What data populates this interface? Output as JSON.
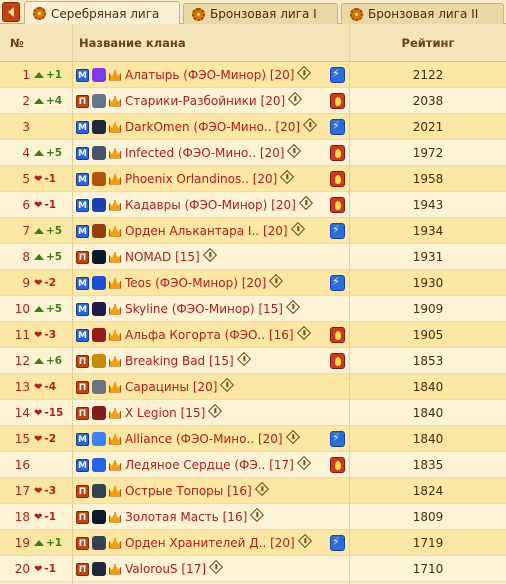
{
  "tabs": [
    {
      "label": "Серебряная лига",
      "active": true
    },
    {
      "label": "Бронзовая лига I",
      "active": false
    },
    {
      "label": "Бронзовая лига II",
      "active": false
    }
  ],
  "header": {
    "num": "№",
    "clan": "Название клана",
    "rating": "Рейтинг"
  },
  "rows": [
    {
      "rank": "1",
      "change": "+1",
      "dir": "up",
      "type": "М",
      "emblem": "#7c3aed",
      "name": "Алатырь (ФЭО-Минор)",
      "level": "[20]",
      "side": "bolt",
      "rating": "2122"
    },
    {
      "rank": "2",
      "change": "+4",
      "dir": "up",
      "type": "П",
      "emblem": "#64748b",
      "name": "Старики-Разбойники",
      "level": "[20]",
      "side": "fire",
      "rating": "2038"
    },
    {
      "rank": "3",
      "change": "",
      "dir": "",
      "type": "М",
      "emblem": "#1f2937",
      "name": "DarkOmen (ФЭО-Мино..",
      "level": "[20]",
      "side": "bolt",
      "rating": "2021"
    },
    {
      "rank": "4",
      "change": "+5",
      "dir": "up",
      "type": "М",
      "emblem": "#475569",
      "name": "Infected (ФЭО-Мино..",
      "level": "[20]",
      "side": "fire",
      "rating": "1972"
    },
    {
      "rank": "5",
      "change": "-1",
      "dir": "down",
      "type": "М",
      "emblem": "#b45309",
      "name": "Phoenix Orlandinos..",
      "level": "[20]",
      "side": "fire",
      "rating": "1958"
    },
    {
      "rank": "6",
      "change": "-1",
      "dir": "down",
      "type": "М",
      "emblem": "#1e40af",
      "name": "Кадавры (ФЭО-Минор)",
      "level": "[20]",
      "side": "fire",
      "rating": "1943"
    },
    {
      "rank": "7",
      "change": "+5",
      "dir": "up",
      "type": "М",
      "emblem": "#92400e",
      "name": "Орден Алькантара I..",
      "level": "[20]",
      "side": "bolt",
      "rating": "1934"
    },
    {
      "rank": "8",
      "change": "+5",
      "dir": "up",
      "type": "П",
      "emblem": "#0f172a",
      "name": "NOMAD",
      "level": "[15]",
      "side": "",
      "rating": "1931"
    },
    {
      "rank": "9",
      "change": "-2",
      "dir": "down",
      "type": "М",
      "emblem": "#1d4ed8",
      "name": "Teos (ФЭО-Минор)",
      "level": "[20]",
      "side": "bolt",
      "rating": "1930"
    },
    {
      "rank": "10",
      "change": "+5",
      "dir": "up",
      "type": "М",
      "emblem": "#1e1b4b",
      "name": "Skyline (ФЭО-Минор)",
      "level": "[15]",
      "side": "",
      "rating": "1909"
    },
    {
      "rank": "11",
      "change": "-3",
      "dir": "down",
      "type": "М",
      "emblem": "#991b1b",
      "name": "Альфа Когорта (ФЭО..",
      "level": "[16]",
      "side": "fire",
      "rating": "1905"
    },
    {
      "rank": "12",
      "change": "+6",
      "dir": "up",
      "type": "П",
      "emblem": "#ca8a04",
      "name": "Breaking Bad",
      "level": "[15]",
      "side": "fire",
      "rating": "1853"
    },
    {
      "rank": "13",
      "change": "-4",
      "dir": "down",
      "type": "П",
      "emblem": "#6b7280",
      "name": "Сарацины",
      "level": "[20]",
      "side": "",
      "rating": "1840"
    },
    {
      "rank": "14",
      "change": "-15",
      "dir": "down",
      "type": "П",
      "emblem": "#7f1d1d",
      "name": "X Legion",
      "level": "[15]",
      "side": "",
      "rating": "1840"
    },
    {
      "rank": "15",
      "change": "-2",
      "dir": "down",
      "type": "М",
      "emblem": "#3b82f6",
      "name": "Alliance (ФЭО-Мино..",
      "level": "[20]",
      "side": "bolt",
      "rating": "1840"
    },
    {
      "rank": "16",
      "change": "",
      "dir": "",
      "type": "М",
      "emblem": "#2563eb",
      "name": "Ледяное Сердце (ФЭ..",
      "level": "[17]",
      "side": "fire",
      "rating": "1835"
    },
    {
      "rank": "17",
      "change": "-3",
      "dir": "down",
      "type": "П",
      "emblem": "#334155",
      "name": "Острые Топоры",
      "level": "[16]",
      "side": "",
      "rating": "1824"
    },
    {
      "rank": "18",
      "change": "-1",
      "dir": "down",
      "type": "П",
      "emblem": "#111827",
      "name": "Золотая Масть",
      "level": "[16]",
      "side": "",
      "rating": "1809"
    },
    {
      "rank": "19",
      "change": "+1",
      "dir": "up",
      "type": "П",
      "emblem": "#374151",
      "name": "Орден Хранителей Д..",
      "level": "[20]",
      "side": "bolt",
      "rating": "1719"
    },
    {
      "rank": "20",
      "change": "-1",
      "dir": "down",
      "type": "П",
      "emblem": "#1f2937",
      "name": "ValorouS",
      "level": "[17]",
      "side": "",
      "rating": "1710"
    }
  ]
}
